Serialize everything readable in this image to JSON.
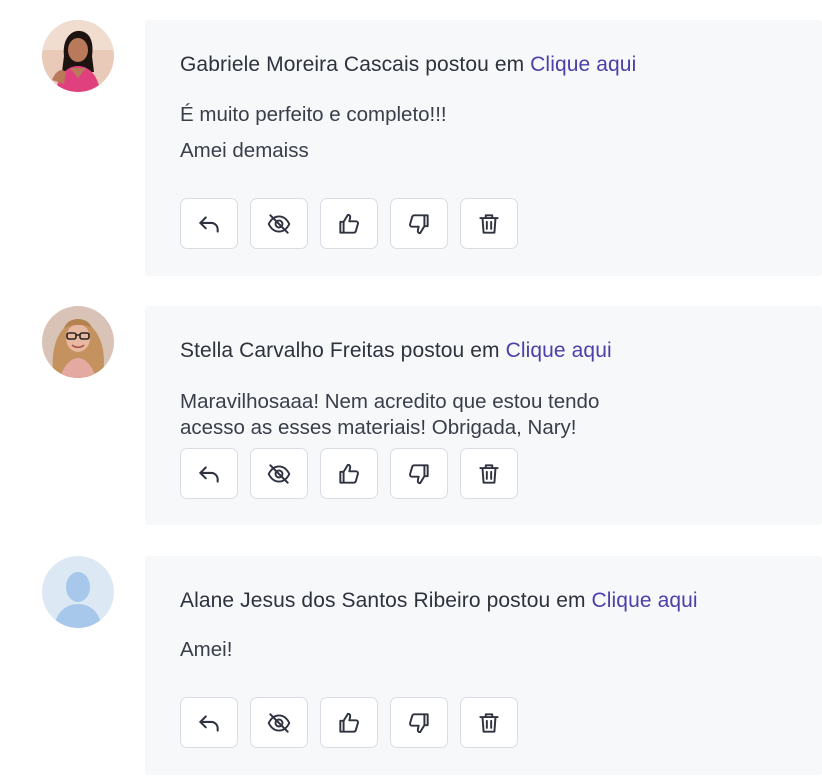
{
  "comments": [
    {
      "author": "Gabriele Moreira Cascais",
      "posted_in": "postou em",
      "link": "Clique aqui",
      "lines": [
        "É muito perfeito e completo!!!",
        "Amei demaiss"
      ],
      "avatar": "user-photo-1"
    },
    {
      "author": "Stella Carvalho Freitas",
      "posted_in": "postou em",
      "link": "Clique aqui",
      "lines": [
        "Maravilhosaaa! Nem acredito que estou tendo",
        "acesso as esses materiais! Obrigada, Nary!"
      ],
      "avatar": "user-photo-2"
    },
    {
      "author": "Alane Jesus dos Santos Ribeiro",
      "posted_in": "postou em",
      "link": "Clique aqui",
      "lines": [
        "Amei!"
      ],
      "avatar": "default-user-avatar"
    }
  ],
  "actions": [
    "reply-icon",
    "hide-icon",
    "thumbs-up-icon",
    "thumbs-down-icon",
    "trash-icon"
  ],
  "colors": {
    "card_bg": "#f6f8fa",
    "link": "#4b3fa8",
    "text": "#2e323d",
    "button_border": "#d9dde3"
  }
}
